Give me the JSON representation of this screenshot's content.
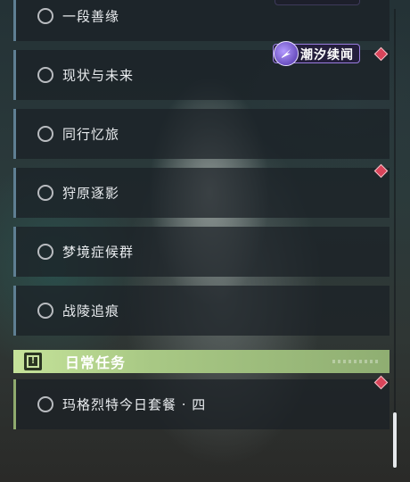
{
  "quests": [
    {
      "label": "一段善缘"
    },
    {
      "label": "现状与未来"
    },
    {
      "label": "同行忆旅"
    },
    {
      "label": "狩原逐影"
    },
    {
      "label": "梦境症候群"
    },
    {
      "label": "战陵追痕"
    }
  ],
  "badge": {
    "label": "潮汐续闻"
  },
  "daily_section": {
    "title": "日常任务",
    "icon_glyph": "!",
    "items": [
      {
        "label": "玛格烈特今日套餐 · 四"
      }
    ]
  },
  "colors": {
    "main_quest_accent": "#5f7f93",
    "daily_accent": "#a9c985",
    "badge_purple": "#9a7de0",
    "alert_diamond": "#d9445a"
  }
}
